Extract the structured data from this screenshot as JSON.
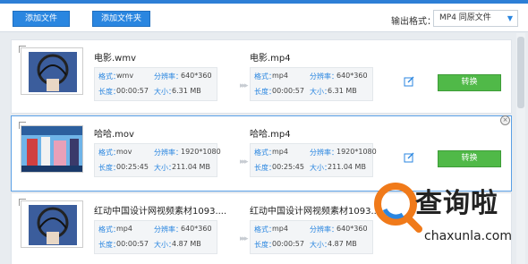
{
  "toolbar": {
    "add_file": "添加文件",
    "add_folder": "添加文件夹",
    "output_label": "输出格式：",
    "output_format": "MP4  同原文件"
  },
  "labels": {
    "format": "格式：",
    "resolution": "分辨率：",
    "duration": "长度：",
    "size": "大小：",
    "convert": "转换"
  },
  "files": [
    {
      "src_name": "电影.wmv",
      "src_format": "wmv",
      "src_resolution": "640*360",
      "src_duration": "00:00:57",
      "src_size": "6.31 MB",
      "dst_name": "电影.mp4",
      "dst_format": "mp4",
      "dst_resolution": "640*360",
      "dst_duration": "00:00:57",
      "dst_size": "6.31 MB"
    },
    {
      "src_name": "哈哈.mov",
      "src_format": "mov",
      "src_resolution": "1920*1080",
      "src_duration": "00:25:45",
      "src_size": "211.04 MB",
      "dst_name": "哈哈.mp4",
      "dst_format": "mp4",
      "dst_resolution": "1920*1080",
      "dst_duration": "00:25:45",
      "dst_size": "211.04 MB"
    },
    {
      "src_name": "红动中国设计网视频素材1093....",
      "src_format": "mp4",
      "src_resolution": "640*360",
      "src_duration": "00:00:57",
      "src_size": "4.87 MB",
      "dst_name": "红动中国设计网视频素材1093....",
      "dst_format": "mp4",
      "dst_resolution": "640*360",
      "dst_duration": "00:00:57",
      "dst_size": "4.87 MB"
    }
  ],
  "watermark": {
    "title": "查询啦",
    "url": "chaxunla.com"
  },
  "colors": {
    "accent_blue": "#2a86e0",
    "convert_green": "#50b948",
    "selected_border": "#5aa0e6"
  }
}
